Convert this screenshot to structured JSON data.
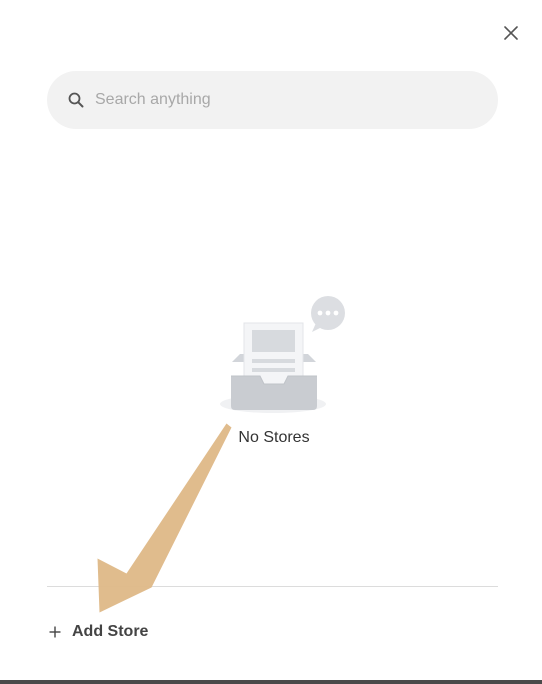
{
  "close": {
    "icon": "close-icon"
  },
  "search": {
    "placeholder": "Search anything",
    "value": "",
    "icon": "search-icon"
  },
  "empty_state": {
    "message": "No Stores",
    "illustration": "empty-inbox-illustration"
  },
  "footer": {
    "add_label": "Add Store",
    "add_icon": "plus-icon"
  },
  "annotation": {
    "icon": "arrow-annotation",
    "color": "#deb887"
  },
  "colors": {
    "search_bg": "#f2f2f2",
    "placeholder": "#a8a8a8",
    "text": "#333333",
    "divider": "#dcdcdc",
    "bottom_border": "#4a4a4a"
  }
}
